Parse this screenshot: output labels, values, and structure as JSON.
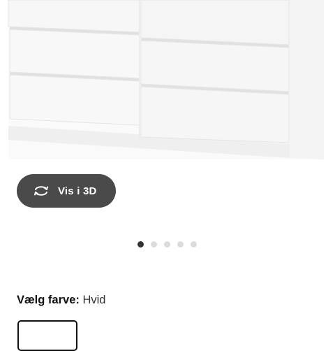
{
  "product": {
    "image_alt": "white dresser with six drawers",
    "view3d_label": "Vis i 3D",
    "carousel": {
      "total": 5,
      "active": 1
    }
  },
  "color": {
    "label": "Vælg farve:",
    "value": "Hvid"
  },
  "icons": {
    "view3d": "rotate-3d-icon"
  },
  "colors": {
    "button_bg": "#4a4a4a",
    "active_dot": "#333333",
    "inactive_dot": "#dcdcdc"
  }
}
